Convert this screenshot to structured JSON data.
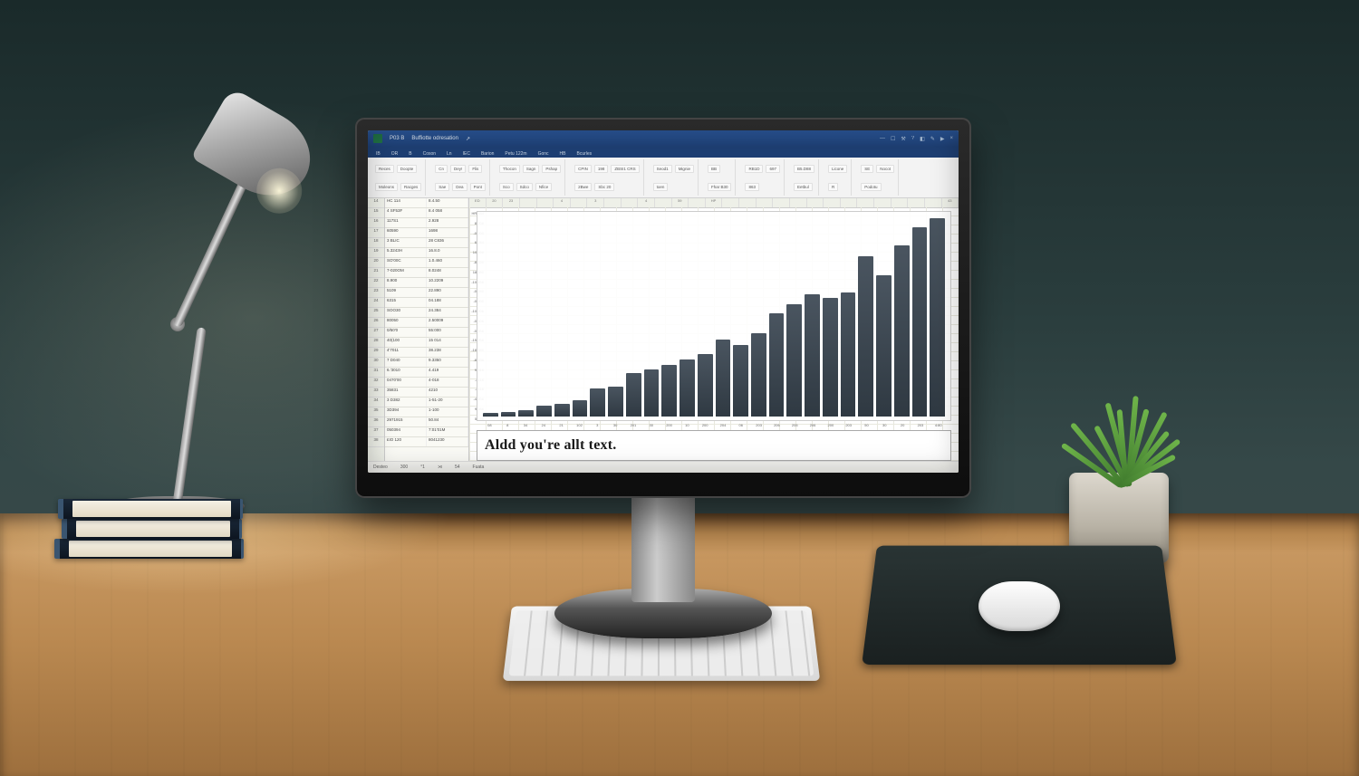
{
  "titlebar": {
    "title": "Buffiotte odresation",
    "product": "P03 B"
  },
  "ribbon": {
    "tabs": [
      "IB",
      "OR",
      "B",
      "Coson",
      "Ln",
      "IEC",
      "Barion",
      "Petu 122m",
      "Gonc",
      "HB",
      "Bcurles"
    ],
    "group1_labels": [
      "Reces",
      "Moleons",
      "Doopte",
      "Racges"
    ],
    "group2_labels": [
      "Cn",
      "Sae",
      "Dey!",
      "Dea",
      "Flis",
      "Pont"
    ],
    "group3_labels": [
      "Thocon",
      "Sco",
      "Sagn",
      "Sdco",
      "Pshap",
      "Nfice"
    ],
    "group4_labels": [
      "CPIN",
      "2Bwe",
      "198",
      "Sbc 20",
      "ZBSI1 CRS"
    ],
    "group5_labels": [
      "Seod1",
      "toen",
      "Mignie"
    ],
    "group6_labels": [
      "BB",
      "Fhar B30"
    ],
    "group7_labels": [
      "RB1D",
      "863",
      "697"
    ],
    "group8_labels": [
      "B5.D88",
      "Eetbul"
    ],
    "group9_labels": [
      "Licone",
      "R"
    ],
    "group10_labels": [
      "SE",
      "Podotu",
      "Nocot"
    ]
  },
  "status": {
    "mode": "Desteo",
    "col": "300",
    "sheet": "°1",
    "flag": "⋊",
    "sel": "54",
    "cell": "Fuata"
  },
  "alt_text": "Aldd you're allt text.",
  "rows": [
    [
      "14",
      "HC 114",
      "8.4.50"
    ],
    [
      "15",
      "4 SF53F",
      "8.4 058"
    ],
    [
      "16",
      "117S1",
      "2.928"
    ],
    [
      "17",
      "60590",
      "1698"
    ],
    [
      "18",
      "3 BLIC",
      "28 C836"
    ],
    [
      "19",
      "5.3243H",
      "16.8.0"
    ],
    [
      "20",
      "SO'00C",
      "1.0.460"
    ],
    [
      "21",
      "7-020OM",
      "8.0248"
    ],
    [
      "22",
      "8.900",
      "10.2209"
    ],
    [
      "23",
      "5109",
      "22.890"
    ],
    [
      "24",
      "6315",
      "04.188"
    ],
    [
      "25",
      "SOO30",
      "24.384"
    ],
    [
      "26",
      "80050",
      "2.50009"
    ],
    [
      "27",
      "0/50'0",
      "55:000"
    ],
    [
      "28",
      "40(100",
      "15 014"
    ],
    [
      "29",
      "4'7011",
      "38.238"
    ],
    [
      "30",
      "7 D040",
      "9.3350"
    ],
    [
      "31",
      "6.'3010",
      "4.419"
    ],
    [
      "32",
      "0470'00",
      "4-018"
    ],
    [
      "33",
      "35831",
      "4210"
    ],
    [
      "34",
      "3 D382",
      "1-51-20"
    ],
    [
      "35",
      "3D394",
      "1-100"
    ],
    [
      "36",
      "2971915",
      "50.84"
    ],
    [
      "37",
      "050394",
      "7:01'01M"
    ],
    [
      "38",
      "£IO 120",
      "8041230"
    ]
  ],
  "chart_data": {
    "type": "bar",
    "categories": [
      "08",
      "8",
      "34",
      "24",
      "21",
      "102",
      "3",
      "30",
      "201",
      "30",
      "200",
      "10",
      "200",
      "204",
      "06",
      "203",
      "206",
      "205",
      "206",
      "200",
      "203",
      "50",
      "30",
      "20",
      "203",
      "4:80"
    ],
    "values": [
      8,
      10,
      14,
      22,
      26,
      34,
      58,
      62,
      90,
      98,
      108,
      120,
      130,
      160,
      150,
      175,
      215,
      235,
      255,
      248,
      260,
      335,
      295,
      358,
      395,
      415
    ],
    "ylim": [
      0,
      420
    ],
    "y_ticks": [
      "HR 184",
      "8-208",
      "-0-200",
      "6-244",
      "10.998",
      "-8-330",
      "18 980",
      "-10-458",
      "-0-040",
      "-0-900",
      "-10-206",
      "-0-306",
      "-0-356",
      "-15-958",
      "-18-980",
      "-8-338",
      "9-316",
      "-4118",
      "-4118",
      "-4-208",
      "9:988",
      "54:88"
    ],
    "title": ""
  }
}
